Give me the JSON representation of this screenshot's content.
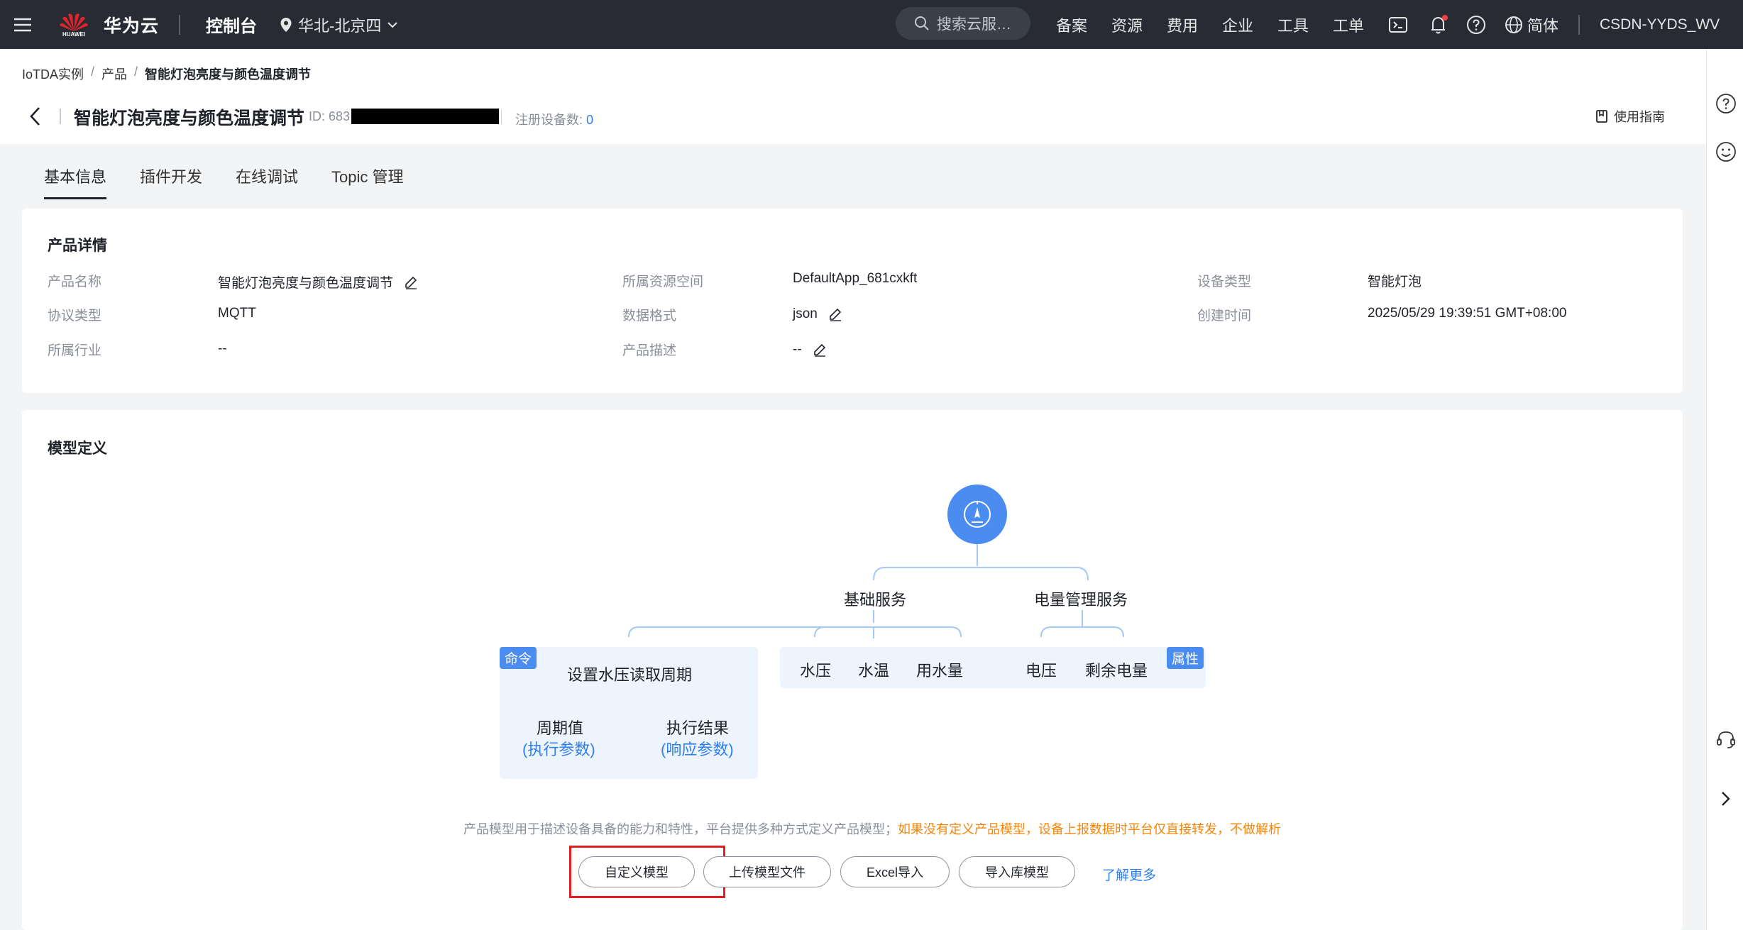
{
  "topbar": {
    "brand": "华为云",
    "logo_text": "HUAWEI",
    "console": "控制台",
    "region": "华北-北京四",
    "search_placeholder": "搜索云服…",
    "nav": [
      "备案",
      "资源",
      "费用",
      "企业",
      "工具",
      "工单"
    ],
    "language": "简体",
    "user": "CSDN-YYDS_WV"
  },
  "breadcrumb": {
    "items": [
      "IoTDA实例",
      "产品",
      "智能灯泡亮度与颜色温度调节"
    ]
  },
  "product_header": {
    "title": "智能灯泡亮度与颜色温度调节",
    "id_label": "ID: 683",
    "device_count_label": "注册设备数:",
    "device_count": "0",
    "guide": "使用指南"
  },
  "tabs": [
    "基本信息",
    "插件开发",
    "在线调试",
    "Topic 管理"
  ],
  "details": {
    "title": "产品详情",
    "fields": [
      {
        "label": "产品名称",
        "value": "智能灯泡亮度与颜色温度调节"
      },
      {
        "label": "协议类型",
        "value": "MQTT"
      },
      {
        "label": "所属行业",
        "value": "--"
      },
      {
        "label": "所属资源空间",
        "value": "DefaultApp_681cxkft"
      },
      {
        "label": "数据格式",
        "value": "json"
      },
      {
        "label": "产品描述",
        "value": "--"
      },
      {
        "label": "设备类型",
        "value": "智能灯泡"
      },
      {
        "label": "创建时间",
        "value": "2025/05/29 19:39:51 GMT+08:00"
      }
    ]
  },
  "model": {
    "title": "模型定义",
    "services": [
      "基础服务",
      "电量管理服务"
    ],
    "command_tag": "命令",
    "property_tag": "属性",
    "command": "设置水压读取周期",
    "command_params": [
      {
        "name": "周期值",
        "type": "(执行参数)"
      },
      {
        "name": "执行结果",
        "type": "(响应参数)"
      }
    ],
    "properties": [
      "水压",
      "水温",
      "用水量",
      "电压",
      "剩余电量"
    ],
    "note": "产品模型用于描述设备具备的能力和特性，平台提供多种方式定义产品模型；",
    "warning": "如果没有定义产品模型，设备上报数据时平台仅直接转发，不做解析",
    "buttons": [
      "自定义模型",
      "上传模型文件",
      "Excel导入",
      "导入库模型"
    ],
    "learn_more": "了解更多"
  }
}
